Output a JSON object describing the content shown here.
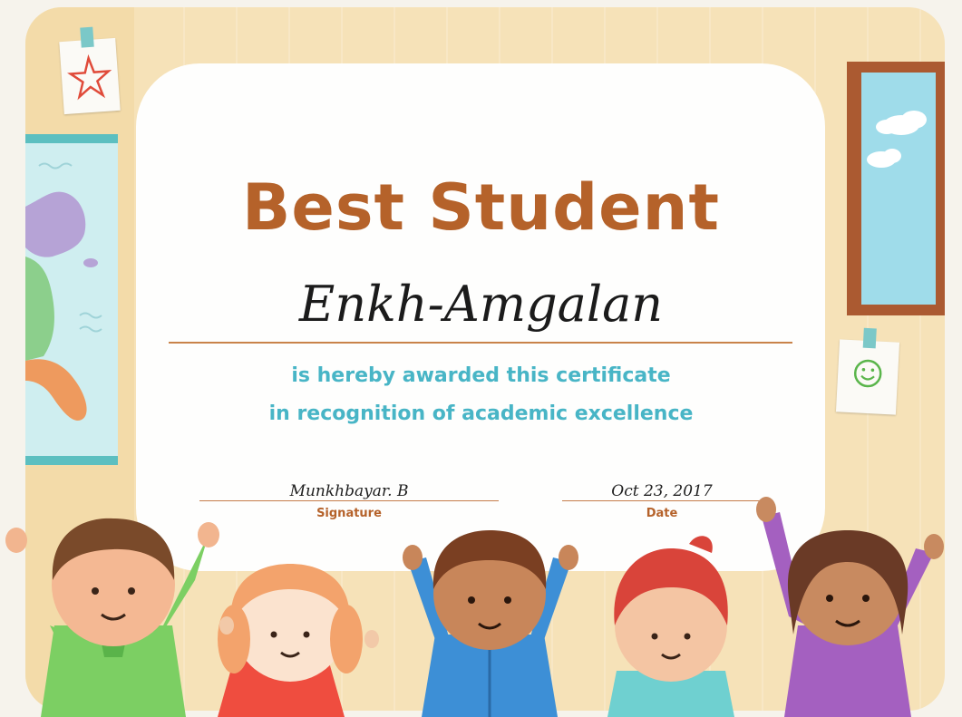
{
  "certificate": {
    "title": "Best Student",
    "recipient": "Enkh-Amgalan",
    "citation_line1": "is hereby awarded this certificate",
    "citation_line2": "in recognition of academic excellence",
    "signature_value": "Munkhbayar. B",
    "signature_label": "Signature",
    "date_value": "Oct 23, 2017",
    "date_label": "Date"
  },
  "colors": {
    "title": "#b5622a",
    "citation": "#48b5c6",
    "frame": "#f6e2b8",
    "paper": "#fefefd"
  },
  "icons": [
    "star-note-icon",
    "smiley-note-icon",
    "cloud-icon",
    "map-icon",
    "window-icon",
    "kid-illustration"
  ]
}
